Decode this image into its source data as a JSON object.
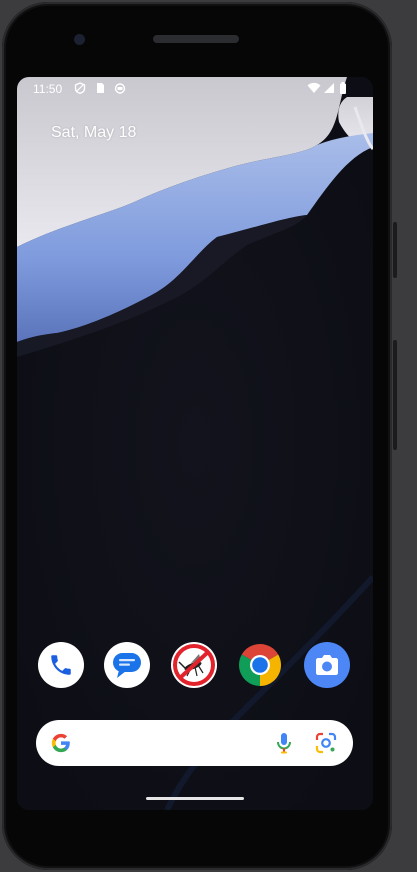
{
  "status_bar": {
    "time": "11:50",
    "left_icons": [
      "vpn-shield-icon",
      "sim-card-icon",
      "android-icon"
    ],
    "right_icons": [
      "wifi-icon",
      "signal-icon",
      "battery-icon"
    ]
  },
  "home": {
    "date": "Sat, May 18"
  },
  "dock": {
    "apps": [
      {
        "icon": "phone-icon"
      },
      {
        "icon": "messages-icon"
      },
      {
        "icon": "mosquito-repellent-icon"
      },
      {
        "icon": "chrome-icon"
      },
      {
        "icon": "camera-icon"
      }
    ]
  },
  "search_bar": {
    "icons": [
      "google-g-icon",
      "microphone-icon",
      "google-lens-icon"
    ]
  },
  "colors": {
    "screen_background": "#0f1018",
    "wallpaper_blue": "#7d98dc",
    "camera_app_blue": "#4d86f5",
    "phone_app_blue": "#1a5fe0",
    "messages_blue": "#1a73e8",
    "mosquito_red": "#e3232c"
  }
}
